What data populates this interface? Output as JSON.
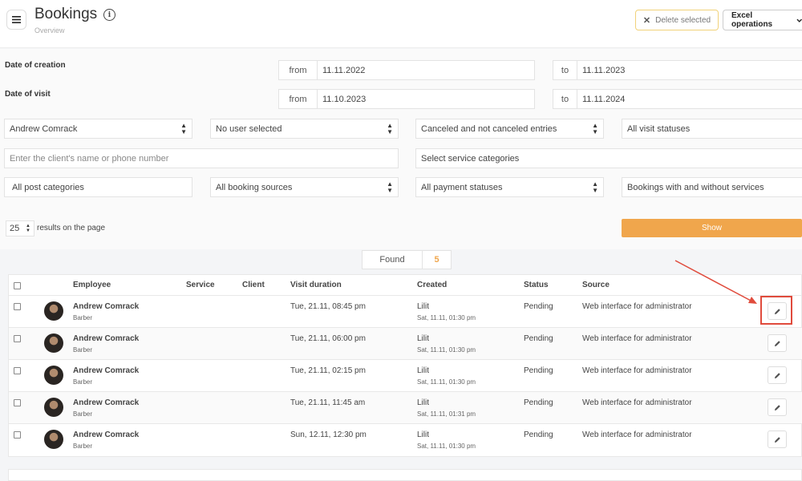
{
  "header": {
    "title": "Bookings",
    "subtitle": "Overview",
    "delete_selected": "Delete selected",
    "excel_operations": "Excel operations"
  },
  "filters": {
    "creation_label": "Date of creation",
    "visit_label": "Date of visit",
    "from_label": "from",
    "to_label": "to",
    "creation_from": "11.11.2022",
    "creation_to": "11.11.2023",
    "visit_from": "11.10.2023",
    "visit_to": "11.11.2024",
    "employee": "Andrew Comrack",
    "user": "No user selected",
    "canceled": "Canceled and not canceled entries",
    "visit_statuses": "All visit statuses",
    "client_placeholder": "Enter the client's name or phone number",
    "service_categories": "Select service categories",
    "post_categories": "All post categories",
    "booking_sources": "All booking sources",
    "payment_statuses": "All payment statuses",
    "services_filter": "Bookings with and without services",
    "per_page": "25",
    "per_page_label": "results on the page",
    "show_button": "Show"
  },
  "found": {
    "label": "Found",
    "count": "5"
  },
  "table": {
    "columns": {
      "employee": "Employee",
      "service": "Service",
      "client": "Client",
      "visit_duration": "Visit duration",
      "created": "Created",
      "status": "Status",
      "source": "Source"
    },
    "rows": [
      {
        "employee": "Andrew Comrack",
        "role": "Barber",
        "visit": "Tue, 21.11, 08:45 pm",
        "created_by": "Lilit",
        "created_at": "Sat, 11.11, 01:30 pm",
        "status": "Pending",
        "source": "Web interface for administrator"
      },
      {
        "employee": "Andrew Comrack",
        "role": "Barber",
        "visit": "Tue, 21.11, 06:00 pm",
        "created_by": "Lilit",
        "created_at": "Sat, 11.11, 01:30 pm",
        "status": "Pending",
        "source": "Web interface for administrator"
      },
      {
        "employee": "Andrew Comrack",
        "role": "Barber",
        "visit": "Tue, 21.11, 02:15 pm",
        "created_by": "Lilit",
        "created_at": "Sat, 11.11, 01:30 pm",
        "status": "Pending",
        "source": "Web interface for administrator"
      },
      {
        "employee": "Andrew Comrack",
        "role": "Barber",
        "visit": "Tue, 21.11, 11:45 am",
        "created_by": "Lilit",
        "created_at": "Sat, 11.11, 01:31 pm",
        "status": "Pending",
        "source": "Web interface for administrator"
      },
      {
        "employee": "Andrew Comrack",
        "role": "Barber",
        "visit": "Sun, 12.11, 12:30 pm",
        "created_by": "Lilit",
        "created_at": "Sat, 11.11, 01:30 pm",
        "status": "Pending",
        "source": "Web interface for administrator"
      }
    ]
  },
  "colors": {
    "accent": "#f0a64c",
    "annotation": "#e04b3c"
  },
  "icons": [
    "hamburger-icon",
    "info-icon",
    "close-icon",
    "chevron-down-icon",
    "sort-caret-icon",
    "pencil-icon"
  ]
}
